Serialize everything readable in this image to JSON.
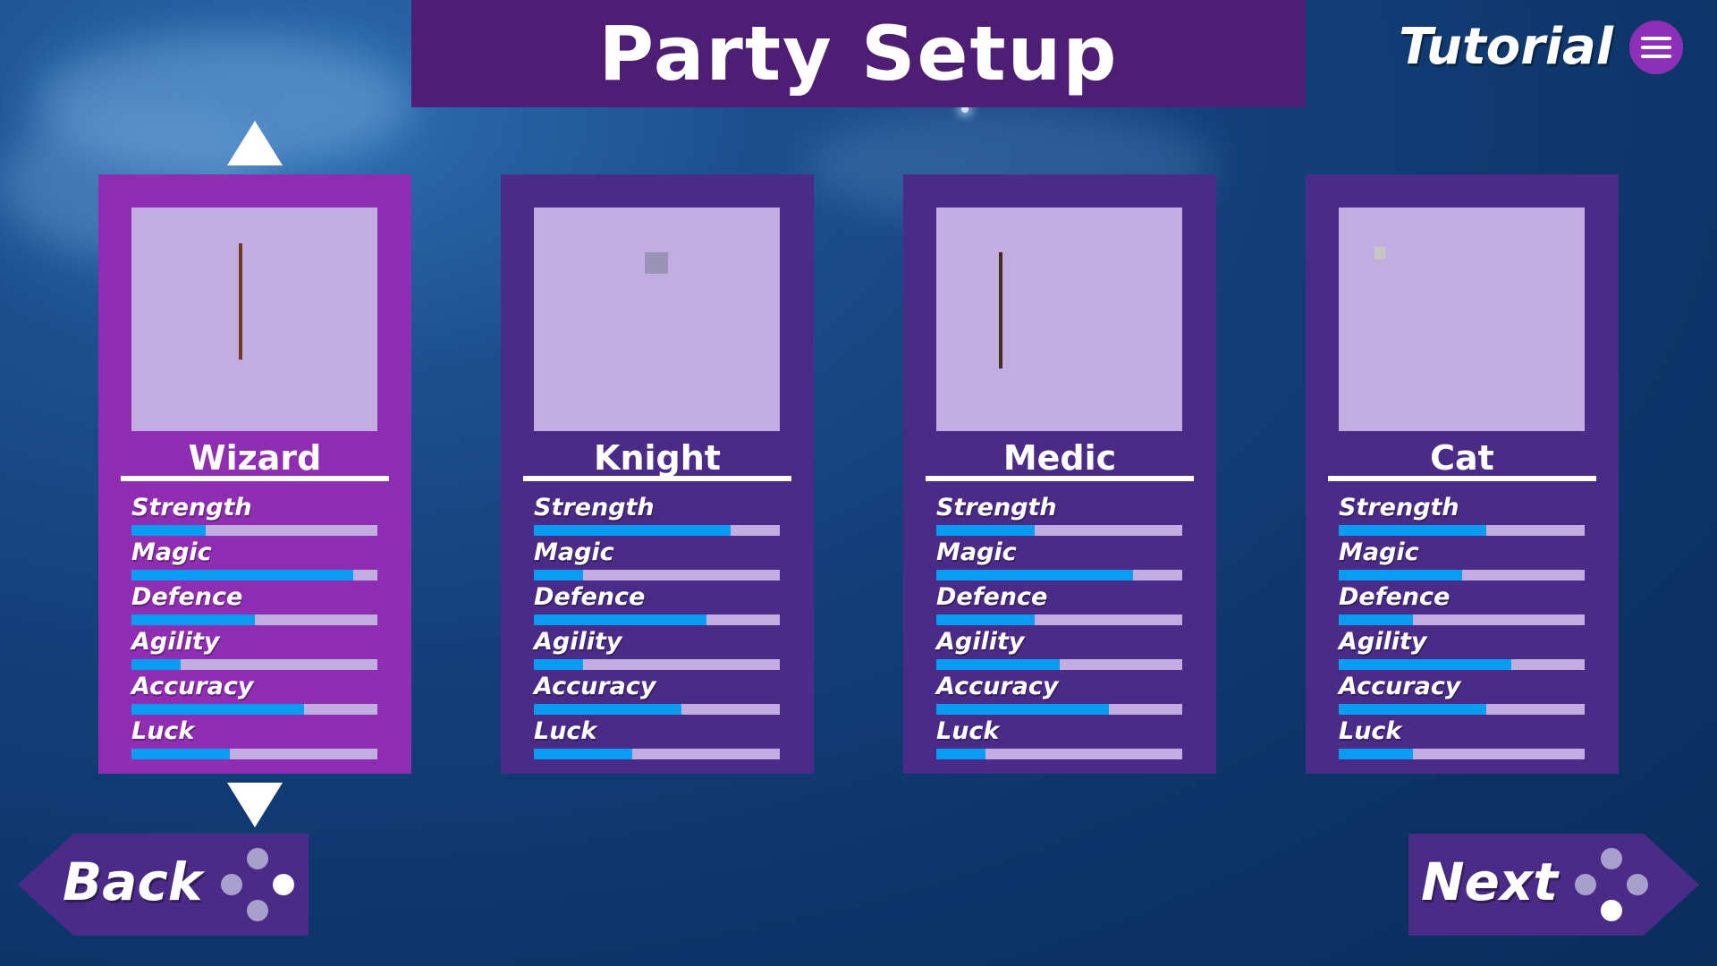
{
  "screen_title": "Party Setup",
  "tutorial": {
    "label": "Tutorial",
    "icon": "menu-icon"
  },
  "navigation": {
    "up_icon": "arrow-up-icon",
    "down_icon": "arrow-down-icon"
  },
  "colors": {
    "background": "#13407a",
    "title_bar": "#4e1e74",
    "card": "#4a2b87",
    "card_selected": "#8f2eb3",
    "portrait_bg": "#c2ade0",
    "bar_track": "#c2ade0",
    "bar_fill": "#0a9cf0",
    "button": "#4a2b87"
  },
  "stat_labels": [
    "Strength",
    "Magic",
    "Defence",
    "Agility",
    "Accuracy",
    "Luck"
  ],
  "characters": [
    {
      "name": "Wizard",
      "selected": true,
      "icon": "wizard-sprite",
      "stats": [
        0.3,
        0.9,
        0.5,
        0.2,
        0.7,
        0.4
      ]
    },
    {
      "name": "Knight",
      "selected": false,
      "icon": "knight-sprite",
      "stats": [
        0.8,
        0.2,
        0.7,
        0.2,
        0.6,
        0.4
      ]
    },
    {
      "name": "Medic",
      "selected": false,
      "icon": "medic-sprite",
      "stats": [
        0.4,
        0.8,
        0.4,
        0.5,
        0.7,
        0.2
      ]
    },
    {
      "name": "Cat",
      "selected": false,
      "icon": "cat-sprite",
      "stats": [
        0.6,
        0.5,
        0.3,
        0.7,
        0.6,
        0.3
      ]
    }
  ],
  "back_button": {
    "label": "Back",
    "icon": "gamepad-buttons-icon",
    "highlight": "right"
  },
  "next_button": {
    "label": "Next",
    "icon": "gamepad-buttons-icon",
    "highlight": "bottom"
  }
}
